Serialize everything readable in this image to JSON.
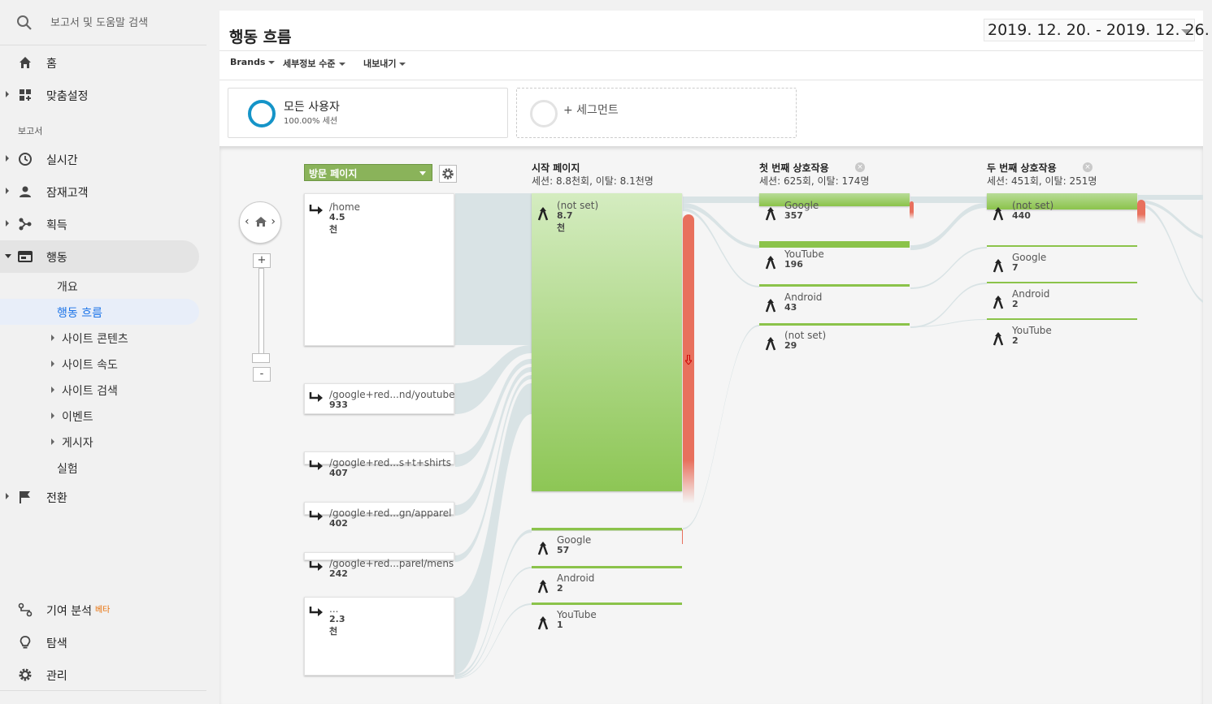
{
  "sidebar": {
    "search_placeholder": "보고서 및 도움말 검색",
    "home": "홈",
    "custom": "맞춤설정",
    "section_reports": "보고서",
    "realtime": "실시간",
    "audience": "잠재고객",
    "acquisition": "획득",
    "behavior": "행동",
    "behavior_sub": {
      "overview": "개요",
      "flow": "행동 흐름",
      "content": "사이트 콘텐츠",
      "speed": "사이트 속도",
      "search": "사이트 검색",
      "events": "이벤트",
      "publisher": "게시자",
      "experiments": "실험"
    },
    "conversions": "전환",
    "attribution": "기여 분석",
    "beta": "베타",
    "discover": "탐색",
    "admin": "관리"
  },
  "header": {
    "title": "행동 흐름",
    "date_range": "2019. 12. 20. - 2019. 12. 26.",
    "toolbar": {
      "brands": "Brands",
      "detail": "세부정보 수준",
      "export": "내보내기"
    }
  },
  "segments": {
    "active_name": "모든 사용자",
    "active_sub": "100.00% 세션",
    "add_label": "+ 세그먼트"
  },
  "flow": {
    "dimension_select": "방문 페이지",
    "columns": [
      {
        "title": "시작 페이지",
        "sub": "세션: 8.8천회, 이탈: 8.1천명"
      },
      {
        "title": "첫 번째 상호작용",
        "sub": "세션: 625회, 이탈: 174명"
      },
      {
        "title": "두 번째 상호작용",
        "sub": "세션: 451회, 이탈: 251명"
      }
    ],
    "landing": [
      {
        "name": "/home",
        "value": "4.5천"
      },
      {
        "name": "/google+red...nd/youtube",
        "value": "933"
      },
      {
        "name": "/google+red...s+t+shirts",
        "value": "407"
      },
      {
        "name": "/google+red...gn/apparel",
        "value": "402"
      },
      {
        "name": "/google+red...parel/mens",
        "value": "242"
      },
      {
        "name": "...",
        "value": "2.3천"
      }
    ],
    "start": [
      {
        "name": "(not set)",
        "value": "8.7천"
      },
      {
        "name": "Google",
        "value": "57"
      },
      {
        "name": "Android",
        "value": "2"
      },
      {
        "name": "YouTube",
        "value": "1"
      }
    ],
    "first": [
      {
        "name": "Google",
        "value": "357"
      },
      {
        "name": "YouTube",
        "value": "196"
      },
      {
        "name": "Android",
        "value": "43"
      },
      {
        "name": "(not set)",
        "value": "29"
      }
    ],
    "second": [
      {
        "name": "(not set)",
        "value": "440"
      },
      {
        "name": "Google",
        "value": "7"
      },
      {
        "name": "Android",
        "value": "2"
      },
      {
        "name": "YouTube",
        "value": "2"
      }
    ]
  },
  "colors": {
    "accent": "#1a73e8",
    "node_green": "#8bc34a",
    "dropoff_red": "#e8705d",
    "flow_gray": "#d6e0e2",
    "segment_ring": "#1594c8"
  }
}
